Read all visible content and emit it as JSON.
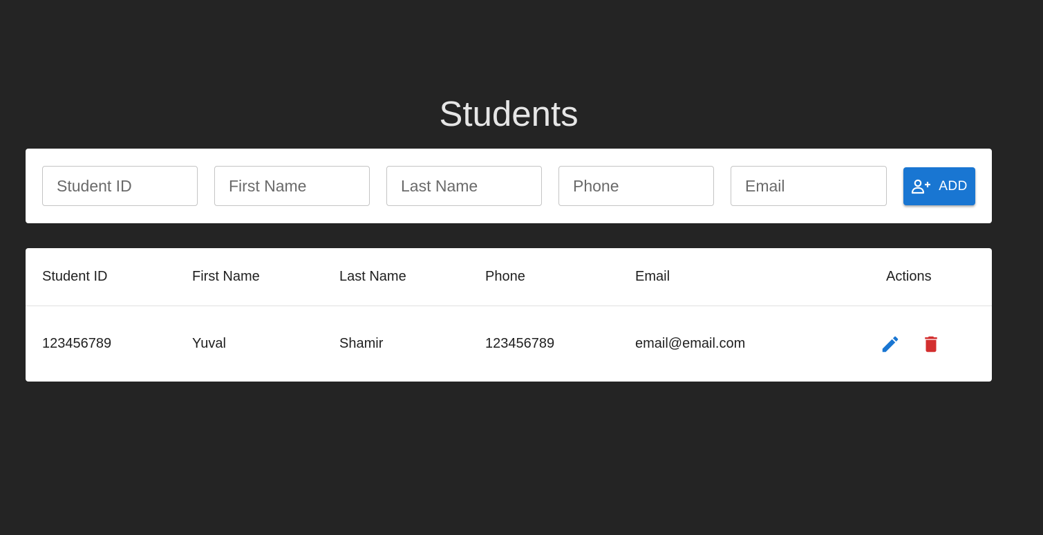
{
  "page": {
    "title": "Students"
  },
  "form": {
    "fields": [
      {
        "placeholder": "Student ID",
        "value": ""
      },
      {
        "placeholder": "First Name",
        "value": ""
      },
      {
        "placeholder": "Last Name",
        "value": ""
      },
      {
        "placeholder": "Phone",
        "value": ""
      },
      {
        "placeholder": "Email",
        "value": ""
      }
    ],
    "add_label": "ADD",
    "add_icon": "person-add-icon"
  },
  "table": {
    "columns": [
      "Student ID",
      "First Name",
      "Last Name",
      "Phone",
      "Email",
      "Actions"
    ],
    "rows": [
      {
        "student_id": "123456789",
        "first_name": "Yuval",
        "last_name": "Shamir",
        "phone": "123456789",
        "email": "email@email.com",
        "actions": [
          "edit-icon",
          "delete-icon"
        ]
      }
    ]
  },
  "colors": {
    "background": "#242424",
    "primary": "#1976d2",
    "danger": "#d32f2f",
    "card": "#ffffff"
  }
}
